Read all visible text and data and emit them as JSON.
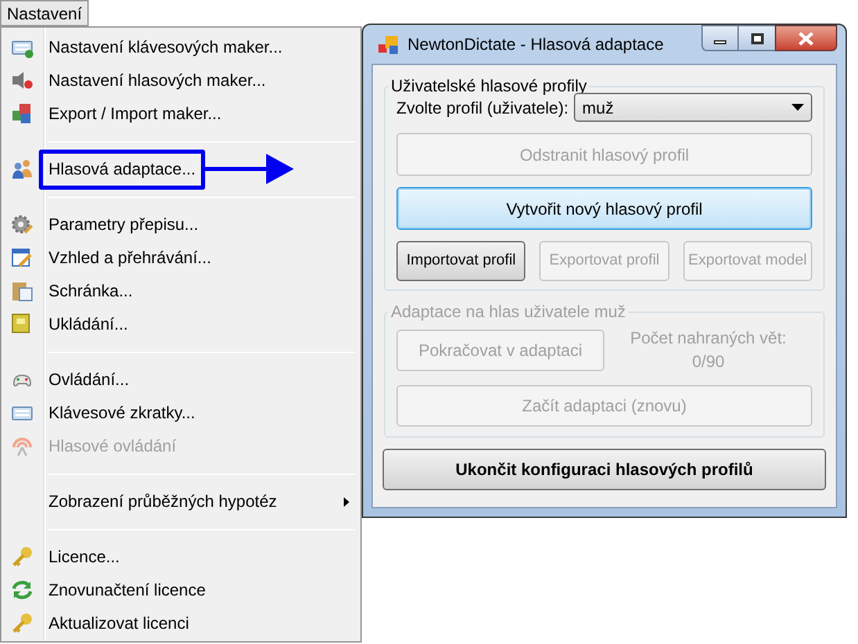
{
  "menu_bar": {
    "title": "Nastavení"
  },
  "menu": {
    "items": [
      {
        "kind": "item",
        "label": "Nastavení klávesových maker...",
        "disabled": false,
        "framed": false
      },
      {
        "kind": "item",
        "label": "Nastavení hlasových maker...",
        "disabled": false,
        "framed": false
      },
      {
        "kind": "item",
        "label": "Export / Import maker...",
        "disabled": false,
        "framed": false
      },
      {
        "kind": "separator"
      },
      {
        "kind": "item",
        "label": "Hlasová adaptace...",
        "disabled": false,
        "framed": true
      },
      {
        "kind": "separator"
      },
      {
        "kind": "item",
        "label": "Parametry přepisu...",
        "disabled": false,
        "framed": false
      },
      {
        "kind": "item",
        "label": "Vzhled a přehrávání...",
        "disabled": false,
        "framed": false
      },
      {
        "kind": "item",
        "label": "Schránka...",
        "disabled": false,
        "framed": false
      },
      {
        "kind": "item",
        "label": "Ukládání...",
        "disabled": false,
        "framed": false
      },
      {
        "kind": "separator"
      },
      {
        "kind": "item",
        "label": "Ovládání...",
        "disabled": false,
        "framed": false
      },
      {
        "kind": "item",
        "label": "Klávesové zkratky...",
        "disabled": false,
        "framed": false
      },
      {
        "kind": "item",
        "label": "Hlasové ovládání",
        "disabled": true,
        "framed": false
      },
      {
        "kind": "separator"
      },
      {
        "kind": "submenu",
        "label": "Zobrazení průběžných hypotéz",
        "disabled": false,
        "framed": false
      },
      {
        "kind": "separator"
      },
      {
        "kind": "item",
        "label": "Licence...",
        "disabled": false,
        "framed": false
      },
      {
        "kind": "item",
        "label": "Znovunačtení licence",
        "disabled": false,
        "framed": false
      },
      {
        "kind": "item",
        "label": "Aktualizovat licenci",
        "disabled": false,
        "framed": false
      }
    ]
  },
  "dialog": {
    "title": "NewtonDictate - Hlasová adaptace",
    "profiles_group": {
      "label": "Uživatelské hlasové profily",
      "profile_label": "Zvolte profil (uživatele):",
      "profile_select": {
        "value": "muž"
      },
      "delete_button": {
        "label": "Odstranit hlasový profil",
        "disabled": true,
        "focused": false
      },
      "create_button": {
        "label": "Vytvořit nový hlasový profil",
        "disabled": false,
        "focused": true
      },
      "buttons": [
        {
          "label": "Importovat profil",
          "disabled": false,
          "focused": false
        },
        {
          "label": "Exportovat profil",
          "disabled": true,
          "focused": false
        },
        {
          "label": "Exportovat model",
          "disabled": true,
          "focused": false
        }
      ]
    },
    "adaptation_group": {
      "label": "Adaptace na hlas uživatele muž",
      "disabled": true,
      "continue_button": {
        "label": "Pokračovat v adaptaci"
      },
      "count_label": "Počet nahraných vět:",
      "count": "0/90",
      "restart_button": {
        "label": "Začít adaptaci (znovu)"
      }
    },
    "finish_button": {
      "label": "Ukončit konfiguraci hlasových profilů"
    }
  }
}
